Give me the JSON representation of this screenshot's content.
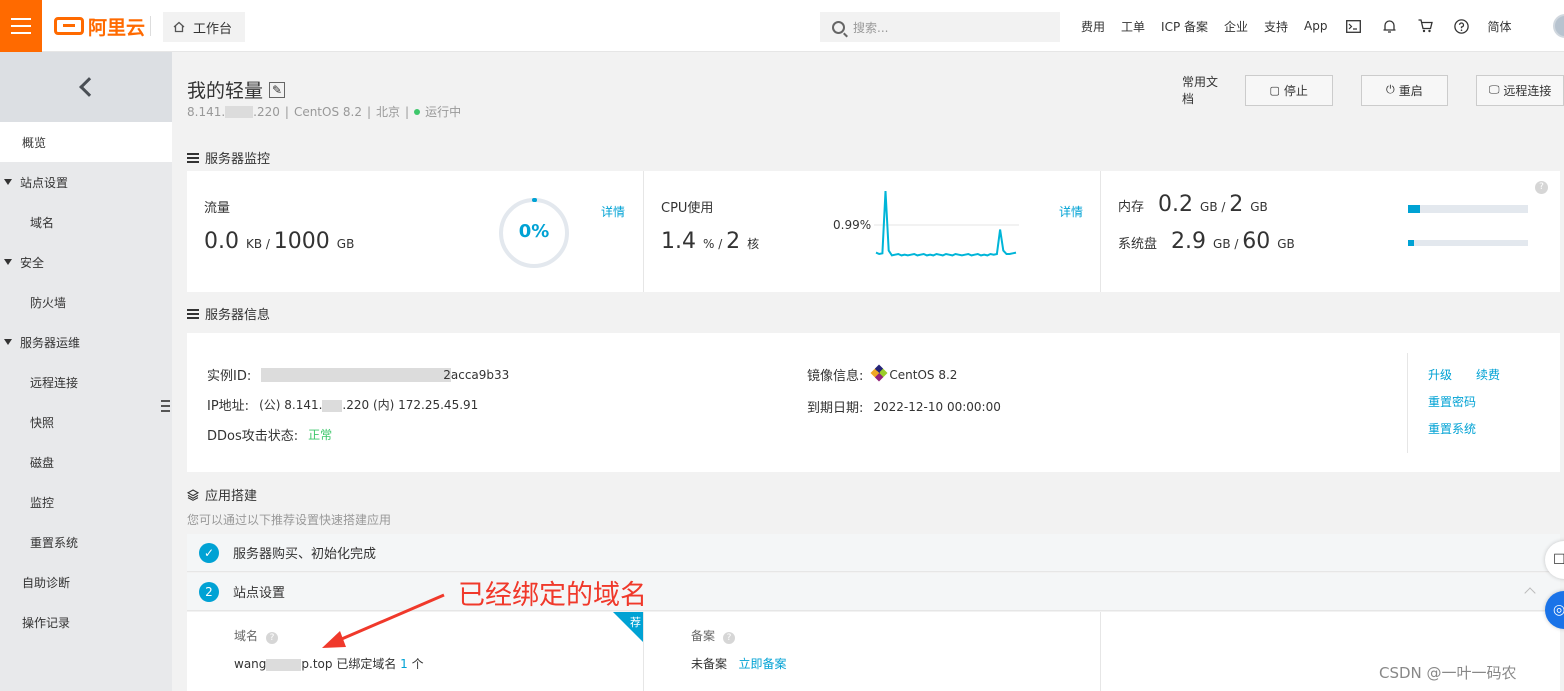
{
  "topbar": {
    "logo_text": "阿里云",
    "workbench": "工作台",
    "search_placeholder": "搜索...",
    "nav": [
      "费用",
      "工单",
      "ICP 备案",
      "企业",
      "支持",
      "App"
    ],
    "lang": "简体"
  },
  "sidebar": {
    "overview": "概览",
    "site_settings": "站点设置",
    "domain": "域名",
    "security": "安全",
    "firewall": "防火墙",
    "ops": "服务器运维",
    "remote": "远程连接",
    "snapshot": "快照",
    "disk": "磁盘",
    "monitor": "监控",
    "reset_system": "重置系统",
    "self_diagnose": "自助诊断",
    "operation_log": "操作记录"
  },
  "header": {
    "title": "我的轻量",
    "ip_prefix": "8.141.",
    "ip_suffix": ".220",
    "os": "CentOS 8.2",
    "region": "北京",
    "status": "运行中",
    "doc_link": "常用文档",
    "stop": "停止",
    "restart": "重启",
    "remote": "远程连接"
  },
  "monitor": {
    "section_title": "服务器监控",
    "traffic_label": "流量",
    "traffic_used": "0.0",
    "traffic_used_unit": "KB",
    "traffic_total": "1000",
    "traffic_total_unit": "GB",
    "traffic_percent_text": "0%",
    "traffic_percent": 0,
    "detail": "详情",
    "cpu_label": "CPU使用",
    "cpu_value": "1.4",
    "cpu_unit": "%",
    "cpu_cores": "2",
    "cpu_cores_unit": "核",
    "cpu_peak_label": "0.99%",
    "cpu_series": [
      0.12,
      0.1,
      0.11,
      1.0,
      0.15,
      0.08,
      0.09,
      0.1,
      0.08,
      0.09,
      0.08,
      0.09,
      0.1,
      0.08,
      0.09,
      0.1,
      0.08,
      0.09,
      0.08,
      0.1,
      0.09,
      0.08,
      0.1,
      0.09,
      0.08,
      0.1,
      0.09,
      0.08,
      0.09,
      0.1,
      0.08,
      0.09,
      0.1,
      0.08,
      0.09,
      0.08,
      0.1,
      0.09,
      0.1,
      0.45,
      0.15,
      0.1,
      0.1,
      0.11,
      0.12
    ],
    "mem_label": "内存",
    "mem_used": "0.2",
    "mem_unit": "GB",
    "mem_total": "2",
    "mem_fraction": 0.1,
    "disk_label": "系统盘",
    "disk_used": "2.9",
    "disk_total": "60",
    "disk_fraction": 0.048
  },
  "info": {
    "section_title": "服务器信息",
    "instance_label": "实例ID:",
    "instance_tail": "2acca9b33",
    "ip_label": "IP地址:",
    "ip_public_prefix": "(公) 8.141.",
    "ip_public_suffix": ".220 (内) 172.25.45.91",
    "ddos_label": "DDos攻击状态:",
    "ddos_value": "正常",
    "image_label": "镜像信息:",
    "image_value": "CentOS 8.2",
    "expire_label": "到期日期:",
    "expire_value": "2022-12-10 00:00:00",
    "upgrade": "升级",
    "renew": "续费",
    "reset_password": "重置密码",
    "reset_system": "重置系统"
  },
  "app": {
    "section_title": "应用搭建",
    "hint": "您可以通过以下推荐设置快速搭建应用",
    "step1_text": "服务器购买、初始化完成",
    "step2_num": "2",
    "step2_text": "站点设置",
    "domain_label": "域名",
    "domain_prefix": "wang",
    "domain_suffix": "p.top",
    "bound_text": "已绑定域名",
    "bound_count": "1",
    "bound_unit": "个",
    "tag": "荐",
    "record_label": "备案",
    "record_status": "未备案",
    "record_link": "立即备案"
  },
  "annotation": {
    "text": "已经绑定的域名"
  },
  "watermark": "CSDN @一叶一码农",
  "colors": {
    "brand": "#ff6a00",
    "accent": "#00a2d4",
    "ok": "#3ec76b",
    "annotation": "#f0392b"
  }
}
